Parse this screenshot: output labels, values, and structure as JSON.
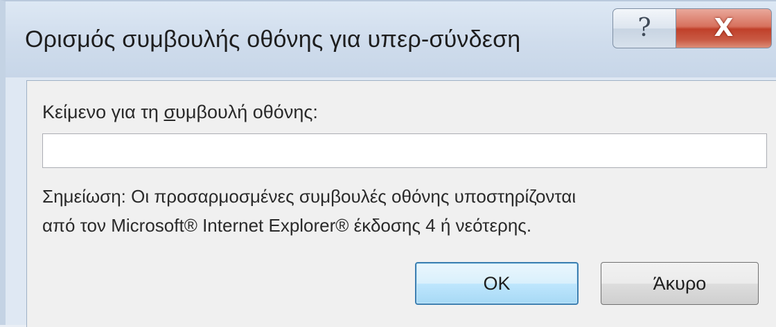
{
  "window": {
    "title": "Ορισμός συμβουλής οθόνης για υπερ-σύνδεση",
    "help_glyph": "?",
    "close_glyph": "X"
  },
  "form": {
    "label_prefix": "Κείμενο για τη ",
    "label_mnemonic": "σ",
    "label_suffix": "υμβουλή οθόνης:",
    "input_value": "",
    "input_placeholder": ""
  },
  "note": {
    "line1": "Σημείωση: Οι προσαρμοσμένες συμβουλές οθόνης υποστηρίζονται",
    "line2": "από τον Microsoft® Internet Explorer® έκδοσης 4 ή νεότερης."
  },
  "buttons": {
    "ok_label": "OK",
    "cancel_label": "Άκυρο"
  },
  "icons": {
    "help": "help-icon",
    "close": "close-icon"
  }
}
